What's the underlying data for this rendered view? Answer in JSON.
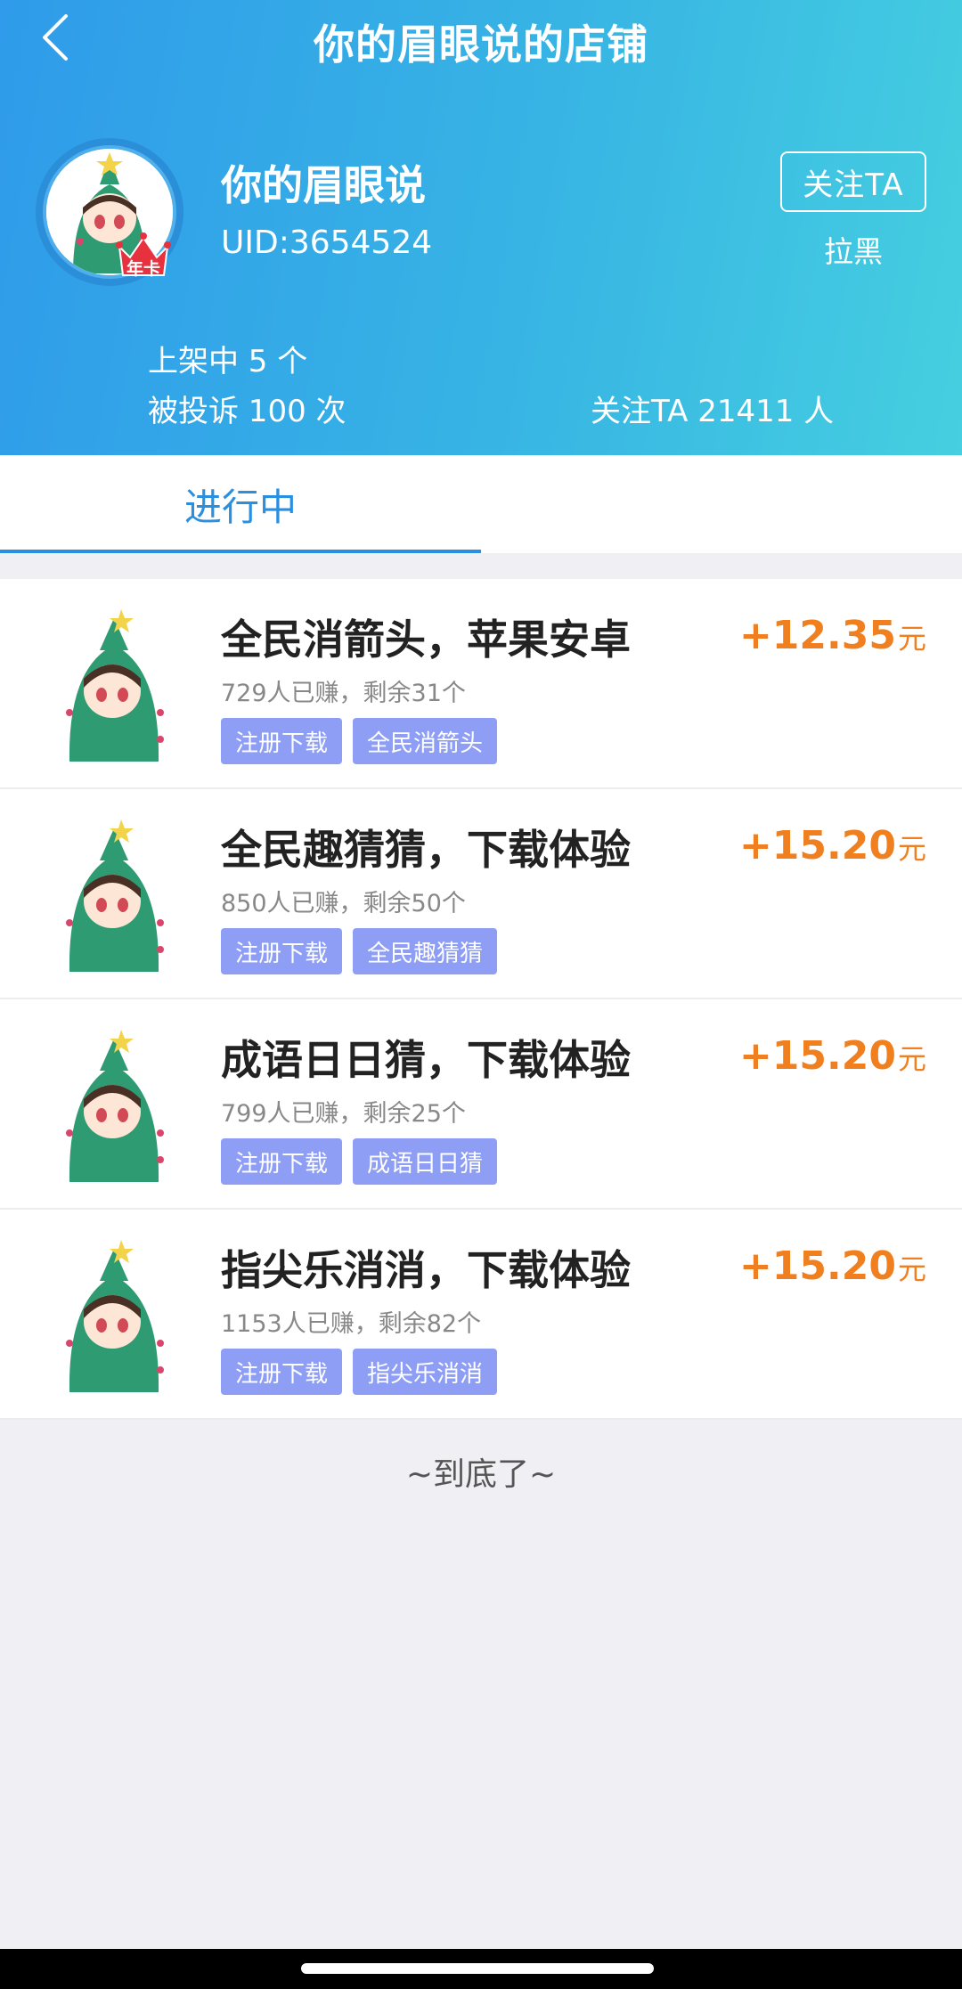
{
  "header": {
    "title": "你的眉眼说的店铺",
    "shop_name": "你的眉眼说",
    "uid": "UID:3654524",
    "follow_label": "关注TA",
    "block_label": "拉黑",
    "badge_text": "年卡",
    "stats": {
      "listed": "上架中 5 个",
      "complaints": "被投诉 100 次",
      "followers": "关注TA 21411 人"
    }
  },
  "tabs": [
    {
      "label": "进行中",
      "active": true
    }
  ],
  "tasks": [
    {
      "title": "全民消箭头，苹果安卓",
      "meta": "729人已赚，剩余31个",
      "tags": [
        "注册下载",
        "全民消箭头"
      ],
      "reward": "+12.35",
      "unit": "元"
    },
    {
      "title": "全民趣猜猜，下载体验",
      "meta": "850人已赚，剩余50个",
      "tags": [
        "注册下载",
        "全民趣猜猜"
      ],
      "reward": "+15.20",
      "unit": "元"
    },
    {
      "title": "成语日日猜，下载体验",
      "meta": "799人已赚，剩余25个",
      "tags": [
        "注册下载",
        "成语日日猜"
      ],
      "reward": "+15.20",
      "unit": "元"
    },
    {
      "title": "指尖乐消消，下载体验",
      "meta": "1153人已赚，剩余82个",
      "tags": [
        "注册下载",
        "指尖乐消消"
      ],
      "reward": "+15.20",
      "unit": "元"
    }
  ],
  "footer": {
    "end_text": "~到底了~"
  },
  "colors": {
    "accent": "#2b8fe0",
    "reward": "#ef7f1f",
    "tag": "#8e9ef5",
    "header_start": "#2f9bea",
    "header_end": "#45cfe0"
  }
}
